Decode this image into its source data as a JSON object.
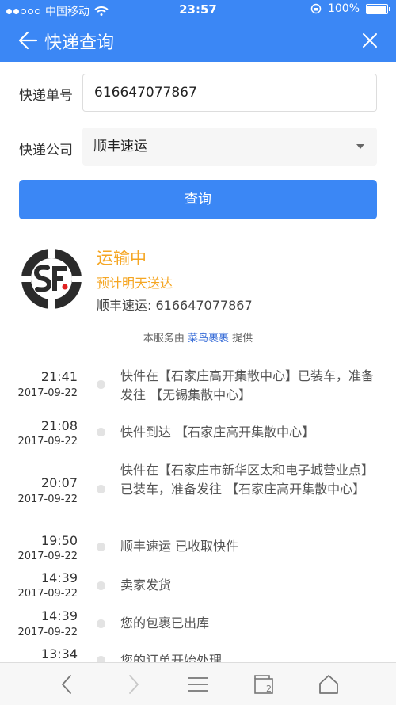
{
  "status_bar": {
    "carrier": "中国移动",
    "time": "23:57",
    "battery": "100%"
  },
  "nav": {
    "title": "快递查询",
    "back_icon": "back-arrow-icon",
    "close_icon": "close-icon"
  },
  "form": {
    "number_label": "快递单号",
    "number_value": "616647077867",
    "company_label": "快递公司",
    "company_value": "顺丰速运",
    "query_button": "查询"
  },
  "result": {
    "logo": "sf-logo",
    "status": "运输中",
    "eta": "预计明天送达",
    "company_number": "顺丰速运:  616647077867",
    "provider_prefix": "本服务由",
    "provider_name": "菜鸟裹裹",
    "provider_suffix": "提供"
  },
  "timeline": [
    {
      "time": "21:41",
      "date": "2017-09-22",
      "desc": "快件在【石家庄高开集散中心】已装车，准备发往 【无锡集散中心】"
    },
    {
      "time": "21:08",
      "date": "2017-09-22",
      "desc": "快件到达 【石家庄高开集散中心】"
    },
    {
      "time": "20:07",
      "date": "2017-09-22",
      "desc": "快件在【石家庄市新华区太和电子城营业点】已装车，准备发往 【石家庄高开集散中心】"
    },
    {
      "time": "19:50",
      "date": "2017-09-22",
      "desc": "顺丰速运 已收取快件"
    },
    {
      "time": "14:39",
      "date": "2017-09-22",
      "desc": "卖家发货"
    },
    {
      "time": "14:39",
      "date": "2017-09-22",
      "desc": "您的包裹已出库"
    },
    {
      "time": "13:34",
      "date": "",
      "desc": "您的订单开始处理"
    }
  ],
  "colors": {
    "accent": "#3b87f5",
    "status": "#f5a623"
  }
}
